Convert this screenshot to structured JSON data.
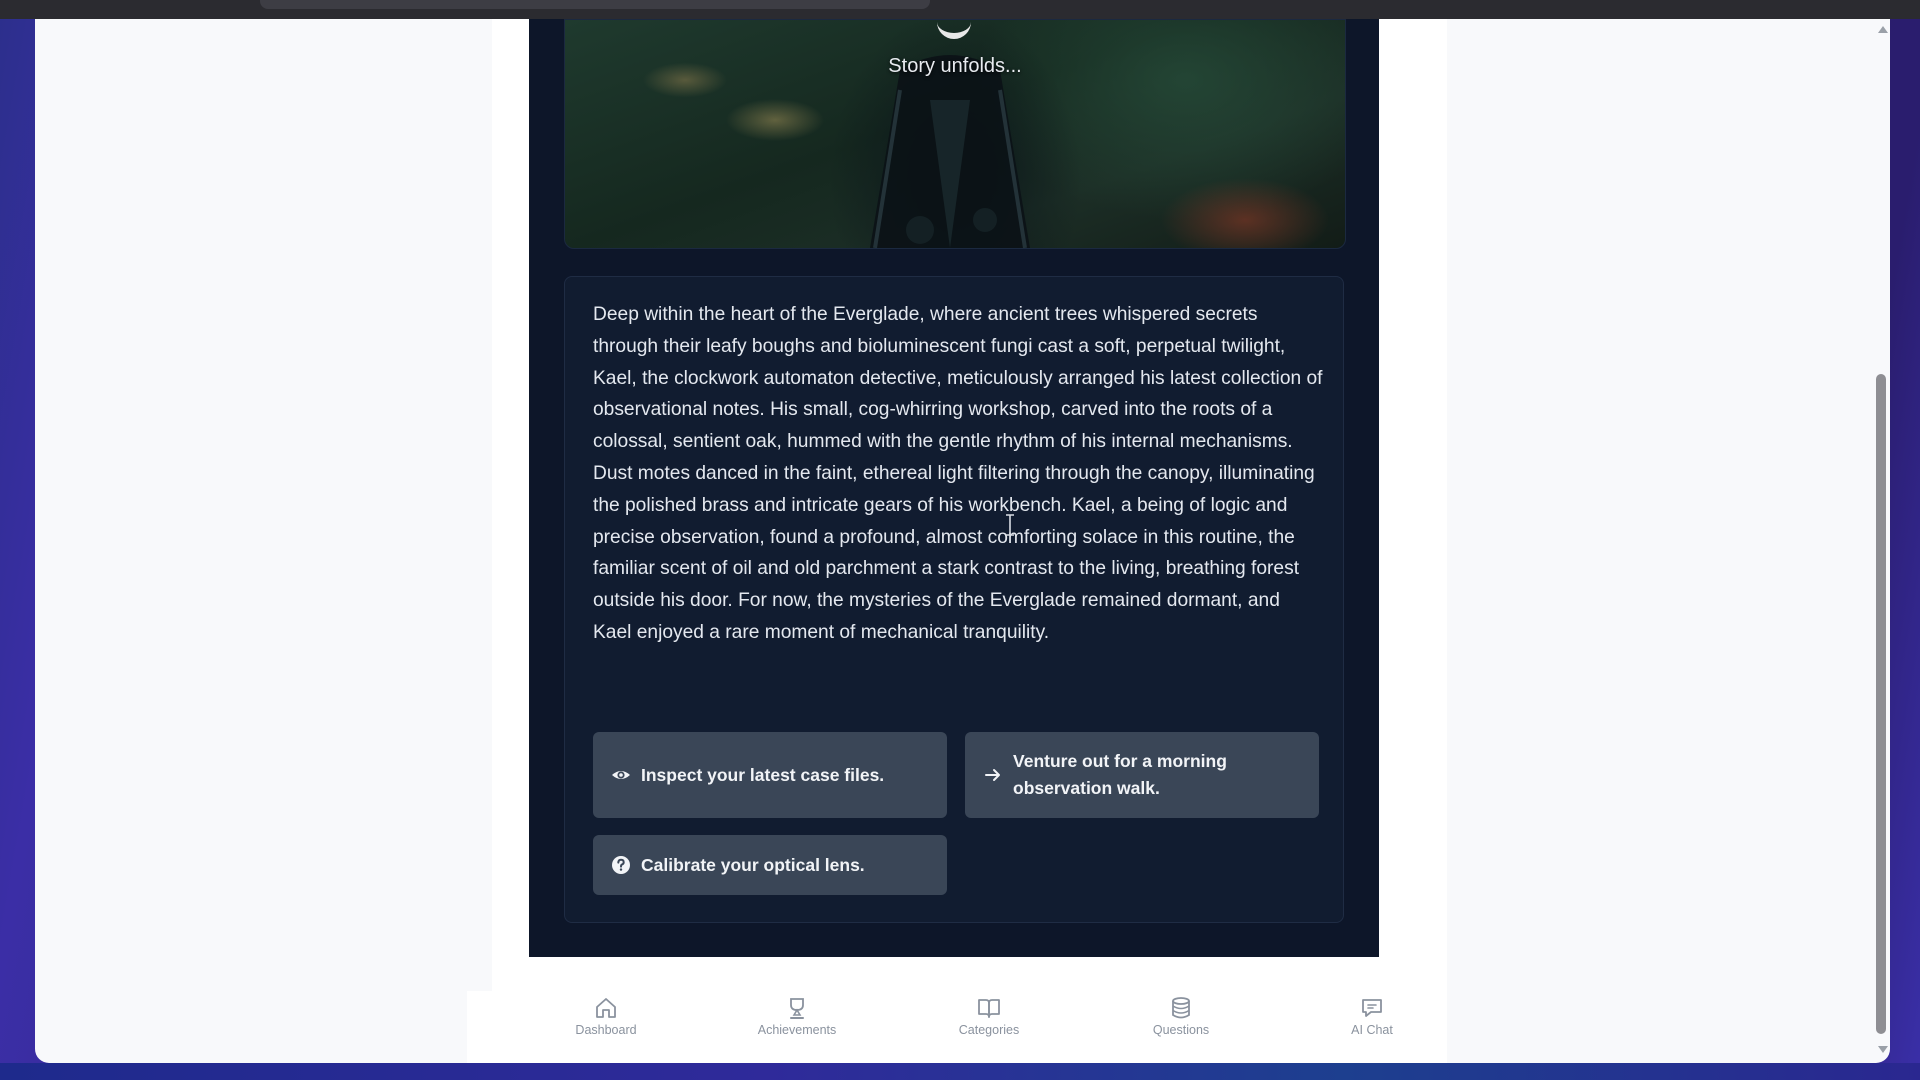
{
  "hero": {
    "caption": "Story unfolds..."
  },
  "story": {
    "text": "Deep within the heart of the Everglade, where ancient trees whispered secrets through their leafy boughs and bioluminescent fungi cast a soft, perpetual twilight, Kael, the clockwork automaton detective, meticulously arranged his latest collection of observational notes. His small, cog-whirring workshop, carved into the roots of a colossal, sentient oak, hummed with the gentle rhythm of his internal mechanisms. Dust motes danced in the faint, ethereal light filtering through the canopy, illuminating the polished brass and intricate gears of his workbench. Kael, a being of logic and precise observation, found a profound, almost comforting solace in this routine, the familiar scent of oil and old parchment a stark contrast to the living, breathing forest outside his door. For now, the mysteries of the Everglade remained dormant, and Kael enjoyed a rare moment of mechanical tranquility."
  },
  "choices": [
    {
      "label": "Inspect your latest case files.",
      "icon": "eye-icon"
    },
    {
      "label": "Venture out for a morning observation walk.",
      "icon": "arrow-right-icon"
    },
    {
      "label": "Calibrate your optical lens.",
      "icon": "question-circle-icon"
    }
  ],
  "nav": {
    "items": [
      {
        "label": "Dashboard",
        "icon": "home-icon"
      },
      {
        "label": "Achievements",
        "icon": "trophy-icon"
      },
      {
        "label": "Categories",
        "icon": "book-icon"
      },
      {
        "label": "Questions",
        "icon": "database-icon"
      },
      {
        "label": "AI Chat",
        "icon": "chat-icon"
      }
    ]
  },
  "colors": {
    "panel": "#0d1629",
    "card": "#111c30",
    "choice": "#3a4657",
    "nav_text": "#8a929e"
  }
}
